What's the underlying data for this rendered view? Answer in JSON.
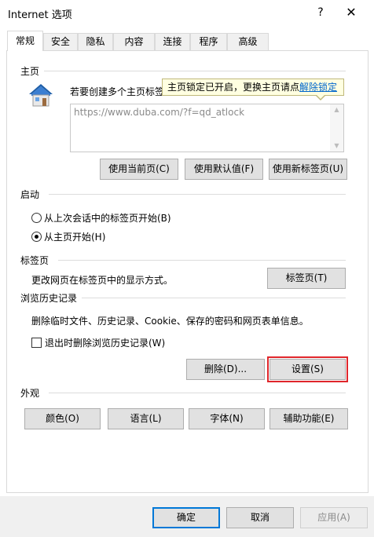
{
  "window": {
    "title": "Internet 选项",
    "help_label": "?",
    "close_label": "✕"
  },
  "tabs": [
    {
      "label": "常规",
      "active": true
    },
    {
      "label": "安全"
    },
    {
      "label": "隐私"
    },
    {
      "label": "内容"
    },
    {
      "label": "连接"
    },
    {
      "label": "程序"
    },
    {
      "label": "高级"
    }
  ],
  "home": {
    "title": "主页",
    "icon": "house-icon",
    "description": "若要创建多个主页标签",
    "tooltip_text": "主页锁定已开启，更换主页请点",
    "tooltip_link": "解除锁定",
    "url": "https://www.duba.com/?f=qd_atlock",
    "btn_current": "使用当前页(C)",
    "btn_default": "使用默认值(F)",
    "btn_newtab": "使用新标签页(U)"
  },
  "startup": {
    "title": "启动",
    "option_last": "从上次会话中的标签页开始(B)",
    "option_home": "从主页开始(H)",
    "selected": "option_home"
  },
  "tabs_section": {
    "title": "标签页",
    "description": "更改网页在标签页中的显示方式。",
    "btn": "标签页(T)"
  },
  "history": {
    "title": "浏览历史记录",
    "description": "删除临时文件、历史记录、Cookie、保存的密码和网页表单信息。",
    "checkbox_label": "退出时删除浏览历史记录(W)",
    "checked": false,
    "btn_delete": "删除(D)...",
    "btn_settings": "设置(S)",
    "highlight_color": "#e0262b"
  },
  "appearance": {
    "title": "外观",
    "btn_colors": "颜色(O)",
    "btn_languages": "语言(L)",
    "btn_fonts": "字体(N)",
    "btn_accessibility": "辅助功能(E)"
  },
  "footer": {
    "ok": "确定",
    "cancel": "取消",
    "apply": "应用(A)",
    "accent": "#0078d7"
  }
}
